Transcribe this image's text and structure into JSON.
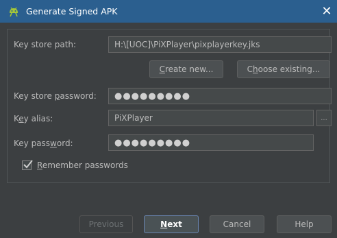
{
  "window": {
    "title": "Generate Signed APK",
    "close_glyph": "✕"
  },
  "form": {
    "keystore_path": {
      "label_before": "Key store path:",
      "value": "H:\\[UOC]\\PiXPlayer\\pixplayerkey.jks"
    },
    "create_new": {
      "accel": "C",
      "rest": "reate new..."
    },
    "choose_existing": {
      "before": "C",
      "accel": "h",
      "rest": "oose existing..."
    },
    "keystore_password": {
      "label_before": "Key store ",
      "label_accel": "p",
      "label_after": "assword:",
      "value": "●●●●●●●●●"
    },
    "key_alias": {
      "label_before": "K",
      "label_accel": "e",
      "label_after": "y alias:",
      "value": "PiXPlayer"
    },
    "key_password": {
      "label_before": "Key pass",
      "label_accel": "w",
      "label_after": "ord:",
      "value": "●●●●●●●●●"
    },
    "ellipsis": "...",
    "remember": {
      "accel": "R",
      "rest": "emember passwords",
      "checked": true
    }
  },
  "footer": {
    "previous": "Previous",
    "next": {
      "accel": "N",
      "rest": "ext"
    },
    "cancel": "Cancel",
    "help": "Help"
  },
  "colors": {
    "titlebar": "#2b5f8f",
    "background": "#3c3f41",
    "android_green": "#a4c639"
  }
}
